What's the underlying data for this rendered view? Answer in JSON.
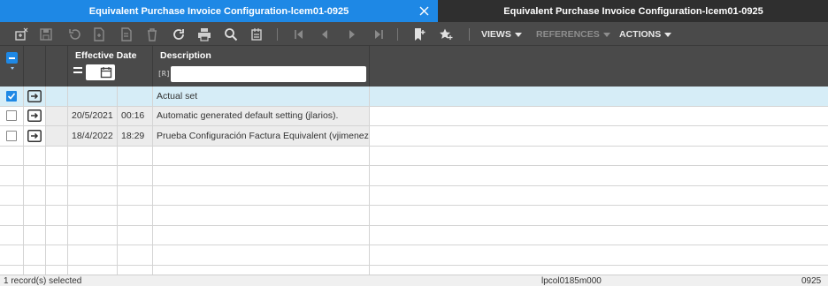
{
  "tabs": [
    {
      "label": "Equivalent Purchase Invoice Configuration-lcem01-0925"
    },
    {
      "label": "Equivalent Purchase Invoice Configuration-lcem01-0925"
    }
  ],
  "toolbar": {
    "menus": [
      {
        "label": "VIEWS"
      },
      {
        "label": "REFERENCES"
      },
      {
        "label": "ACTIONS"
      }
    ]
  },
  "grid": {
    "columns": [
      {
        "label": "Effective Date"
      },
      {
        "label": "Description"
      }
    ],
    "description_filter_prefix": "[R]",
    "rows": [
      {
        "selected": true,
        "date": "",
        "time": "",
        "description": "Actual set"
      },
      {
        "selected": false,
        "date": "20/5/2021",
        "time": "00:16",
        "description": "Automatic generated default setting (jlarios)."
      },
      {
        "selected": false,
        "date": "18/4/2022",
        "time": "18:29",
        "description": "Prueba Configuración Factura Equivalent (vjimenez)"
      }
    ]
  },
  "status": {
    "records": "1 record(s) selected",
    "session": "lpcol0185m000",
    "company": "0925"
  },
  "colors": {
    "accent": "#1e88e5",
    "toolbar_bg": "#4a4a4a",
    "selected_row": "#d6edf7"
  }
}
